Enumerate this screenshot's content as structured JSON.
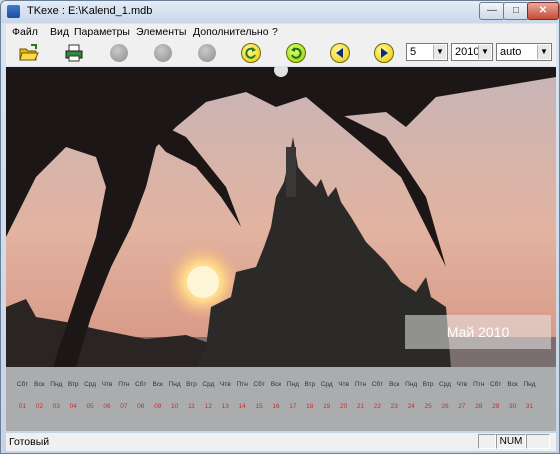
{
  "window": {
    "title": "TKexe : E:\\Kalend_1.mdb"
  },
  "menu": [
    "Файл",
    "Вид",
    "Параметры",
    "Элементы",
    "Дополнительно",
    "?"
  ],
  "toolbar": {
    "day": "5",
    "year": "2010",
    "mode": "auto"
  },
  "calendar": {
    "month_label": "Май 2010",
    "day_names": [
      "Сбт",
      "Вск",
      "Пнд",
      "Втр",
      "Срд",
      "Чтв",
      "Птн",
      "Сбт",
      "Вск",
      "Пнд",
      "Втр",
      "Срд",
      "Чтв",
      "Птн",
      "Сбт",
      "Вск",
      "Пнд",
      "Втр",
      "Срд",
      "Чтв",
      "Птн",
      "Сбт",
      "Вск",
      "Пнд",
      "Втр",
      "Срд",
      "Чтв",
      "Птн",
      "Сбт",
      "Вск",
      "Пнд"
    ],
    "days": [
      "01",
      "02",
      "03",
      "04",
      "05",
      "06",
      "07",
      "08",
      "09",
      "10",
      "11",
      "12",
      "13",
      "14",
      "15",
      "16",
      "17",
      "18",
      "19",
      "20",
      "21",
      "22",
      "23",
      "24",
      "25",
      "26",
      "27",
      "28",
      "29",
      "30",
      "31"
    ],
    "colors": {
      "weekend": "#c0322b",
      "weekday": "#c0322b",
      "highlight": "#1a1a1a"
    }
  },
  "statusbar": {
    "text": "Готовый",
    "num": "NUM"
  },
  "icons": [
    "open-folder-icon",
    "print-icon",
    "gray-dot-icon",
    "rotate-left-icon",
    "rotate-right-icon",
    "prev-arrow-icon",
    "next-arrow-icon"
  ]
}
